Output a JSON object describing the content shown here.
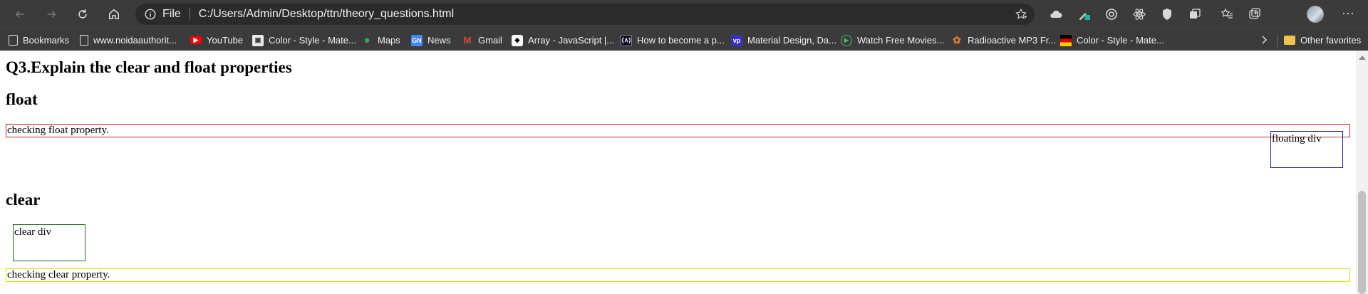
{
  "browser": {
    "address": {
      "scheme": "File",
      "url": "C:/Users/Admin/Desktop/ttn/theory_questions.html"
    },
    "bookmarks": [
      {
        "label": "Bookmarks",
        "icon": "bookmarks-icon"
      },
      {
        "label": "www.noidaauthorit...",
        "icon": "page-icon"
      },
      {
        "label": "YouTube",
        "icon": "youtube-icon"
      },
      {
        "label": "Color - Style - Mate...",
        "icon": "material-icon"
      },
      {
        "label": "Maps",
        "icon": "maps-icon"
      },
      {
        "label": "News",
        "icon": "news-icon"
      },
      {
        "label": "Gmail",
        "icon": "gmail-icon"
      },
      {
        "label": "Array - JavaScript |...",
        "icon": "mdn-icon"
      },
      {
        "label": "How to become a p...",
        "icon": "freecodecamp-icon"
      },
      {
        "label": "Material Design, Da...",
        "icon": "vp-icon"
      },
      {
        "label": "Watch Free Movies...",
        "icon": "play-circle-icon"
      },
      {
        "label": "Radioactive MP3 Fr...",
        "icon": "paw-icon"
      },
      {
        "label": "Color - Style - Mate...",
        "icon": "flag-icon"
      }
    ],
    "other_favorites": "Other favorites"
  },
  "page": {
    "question_heading": "Q3.Explain the clear and float properties",
    "float_heading": "float",
    "float_paragraph": "checking float property.",
    "floating_div": "floating div",
    "clear_heading": "clear",
    "clear_div": "clear div",
    "clear_paragraph": "checking clear property."
  },
  "colors": {
    "float_paragraph_border": "#c0282d",
    "floating_div_border": "#1a1aa0",
    "clear_div_border": "#1d6b1d",
    "clear_paragraph_border": "#e0e000"
  }
}
